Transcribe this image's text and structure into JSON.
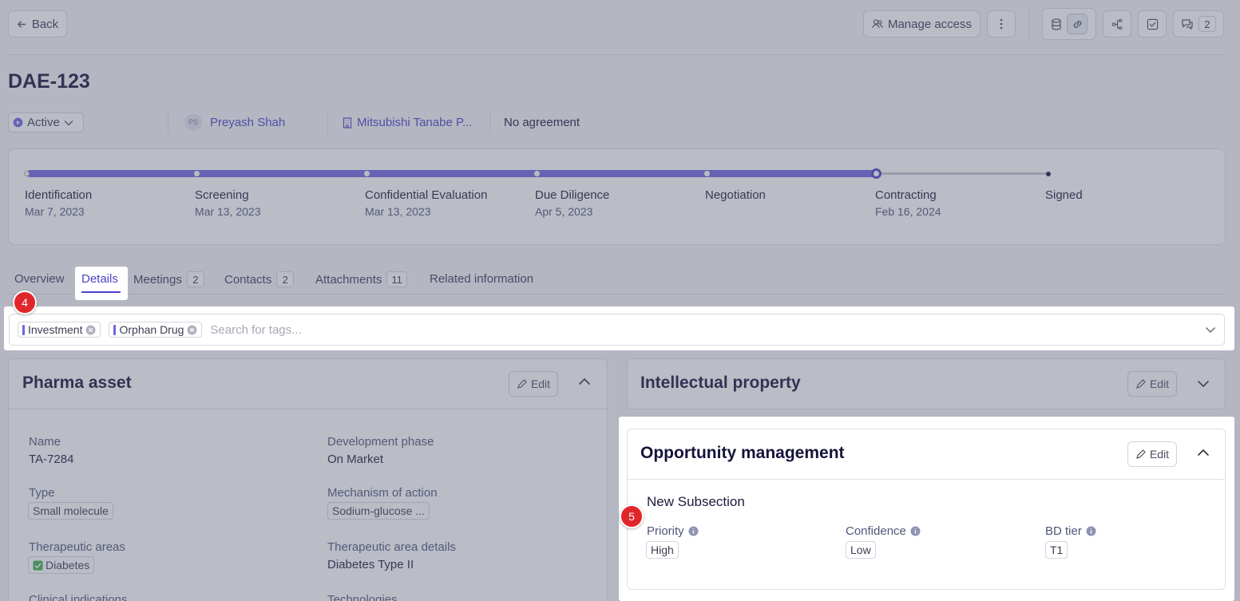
{
  "header": {
    "back_label": "Back",
    "manage_access_label": "Manage access",
    "comments_count": "2"
  },
  "deal": {
    "title": "DAE-123",
    "status": "Active",
    "owner_initials": "PS",
    "owner": "Preyash Shah",
    "company": "Mitsubishi Tanabe P...",
    "agreement": "No agreement"
  },
  "stages": [
    {
      "name": "Identification",
      "date": "Mar 7, 2023"
    },
    {
      "name": "Screening",
      "date": "Mar 13, 2023"
    },
    {
      "name": "Confidential Evaluation",
      "date": "Mar 13, 2023"
    },
    {
      "name": "Due Diligence",
      "date": "Apr 5, 2023"
    },
    {
      "name": "Negotiation",
      "date": ""
    },
    {
      "name": "Contracting",
      "date": "Feb 16, 2024"
    },
    {
      "name": "Signed",
      "date": ""
    }
  ],
  "tabs": [
    {
      "label": "Overview",
      "count": ""
    },
    {
      "label": "Details",
      "count": ""
    },
    {
      "label": "Meetings",
      "count": "2"
    },
    {
      "label": "Contacts",
      "count": "2"
    },
    {
      "label": "Attachments",
      "count": "11"
    },
    {
      "label": "Related information",
      "count": ""
    }
  ],
  "tags": {
    "items": [
      "Investment",
      "Orphan Drug"
    ],
    "placeholder": "Search for tags..."
  },
  "badges": {
    "tags": "4",
    "subsection": "5"
  },
  "pharma_asset": {
    "title": "Pharma asset",
    "edit_label": "Edit",
    "fields": {
      "name_label": "Name",
      "name_value": "TA-7284",
      "phase_label": "Development phase",
      "phase_value": "On Market",
      "type_label": "Type",
      "type_value": "Small molecule",
      "moa_label": "Mechanism of action",
      "moa_value": "Sodium-glucose ...",
      "areas_label": "Therapeutic areas",
      "areas_value": "Diabetes",
      "area_details_label": "Therapeutic area details",
      "area_details_value": "Diabetes Type II",
      "indications_label": "Clinical indications",
      "technologies_label": "Technologies"
    }
  },
  "ip": {
    "title": "Intellectual property",
    "edit_label": "Edit"
  },
  "opportunity": {
    "title": "Opportunity management",
    "edit_label": "Edit",
    "subsection": "New Subsection",
    "priority_label": "Priority",
    "priority_value": "High",
    "confidence_label": "Confidence",
    "confidence_value": "Low",
    "tier_label": "BD tier",
    "tier_value": "T1"
  },
  "colors": {
    "accent": "#4b43c9",
    "badge": "#e0262b",
    "progress": "#6e66e0"
  }
}
